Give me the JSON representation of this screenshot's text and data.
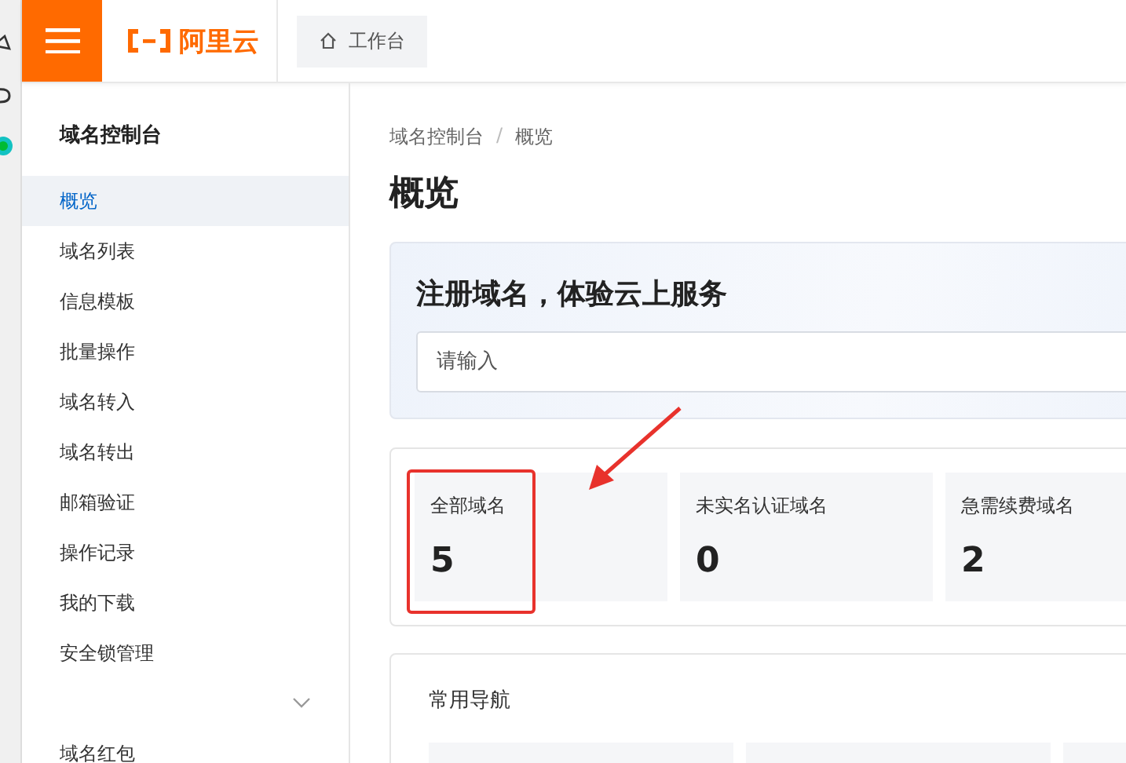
{
  "header": {
    "logo": "阿里云",
    "tab": "工作台"
  },
  "sidebar": {
    "title": "域名控制台",
    "items": [
      {
        "label": "概览",
        "selected": true,
        "kind": "link"
      },
      {
        "label": "域名列表",
        "selected": false,
        "kind": "link"
      },
      {
        "label": "信息模板",
        "selected": false,
        "kind": "link"
      },
      {
        "label": "批量操作",
        "selected": false,
        "kind": "link"
      },
      {
        "label": "域名转入",
        "selected": false,
        "kind": "link"
      },
      {
        "label": "域名转出",
        "selected": false,
        "kind": "link"
      },
      {
        "label": "邮箱验证",
        "selected": false,
        "kind": "link"
      },
      {
        "label": "操作记录",
        "selected": false,
        "kind": "link"
      },
      {
        "label": "我的下载",
        "selected": false,
        "kind": "link"
      },
      {
        "label": "安全锁管理",
        "selected": false,
        "kind": "link"
      },
      {
        "selected": false,
        "kind": "group"
      },
      {
        "label": "域名红包",
        "selected": false,
        "kind": "link"
      }
    ]
  },
  "breadcrumb": [
    "域名控制台",
    "概览"
  ],
  "breadcrumb_separator": "/",
  "page_title": "概览",
  "banner": {
    "title": "注册域名，体验云上服务",
    "placeholder": "请输入"
  },
  "stats": [
    {
      "label": "全部域名",
      "value": "5",
      "highlighted": true
    },
    {
      "label": "未实名认证域名",
      "value": "0",
      "highlighted": false
    },
    {
      "label": "急需续费域名",
      "value": "2",
      "highlighted": false
    }
  ],
  "navigation": {
    "title": "常用导航"
  }
}
